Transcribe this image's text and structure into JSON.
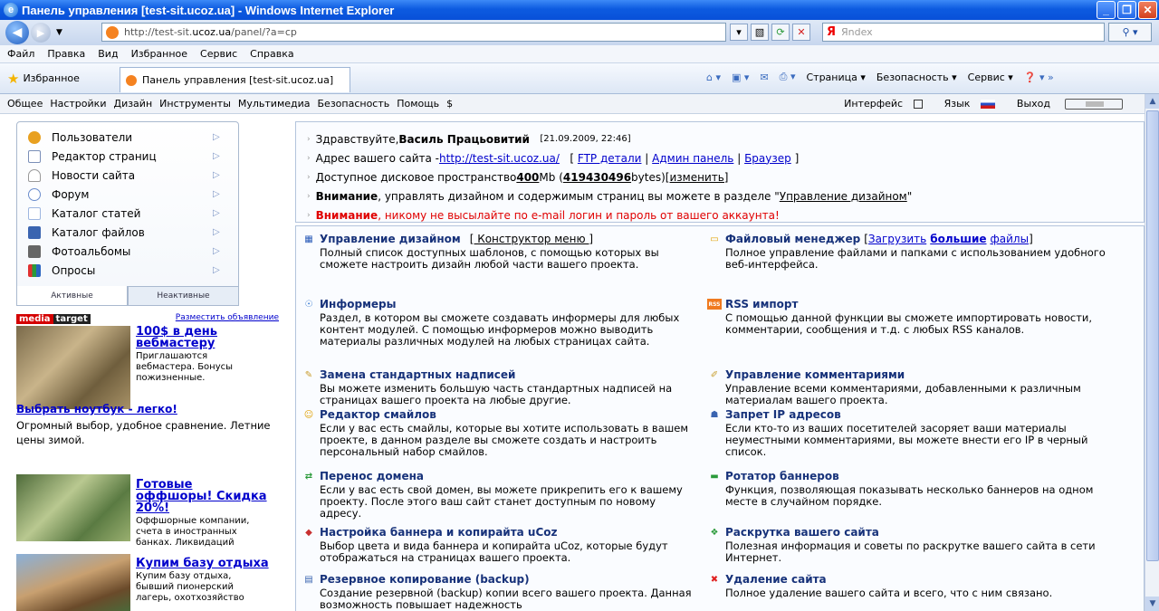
{
  "window": {
    "title": "Панель управления [test-sit.ucoz.ua] - Windows Internet Explorer"
  },
  "address": {
    "prefix": "http://test-sit.",
    "host": "ucoz.ua",
    "path": "/panel/?a=cp"
  },
  "search": {
    "placeholder": "Яndex",
    "logo": "Я"
  },
  "menu": [
    "Файл",
    "Правка",
    "Вид",
    "Избранное",
    "Сервис",
    "Справка"
  ],
  "favorites": {
    "label": "Избранное",
    "tab": "Панель управления [test-sit.ucoz.ua]"
  },
  "commands": {
    "page": "Страница ▾",
    "security": "Безопасность ▾",
    "service": "Сервис ▾"
  },
  "topnav": {
    "items": [
      "Общее",
      "Настройки",
      "Дизайн",
      "Инструменты",
      "Мультимедиа",
      "Безопасность",
      "Помощь",
      "$"
    ],
    "interface": "Интерфейс",
    "language": "Язык",
    "logout": "Выход"
  },
  "sidebar": {
    "items": [
      {
        "label": "Пользователи",
        "color": "#e8a020"
      },
      {
        "label": "Редактор страниц",
        "color": "#7a8fb8"
      },
      {
        "label": "Новости сайта",
        "color": "#c0c8d8"
      },
      {
        "label": "Форум",
        "color": "#6a8ccc"
      },
      {
        "label": "Каталог статей",
        "color": "#9db6e0"
      },
      {
        "label": "Каталог файлов",
        "color": "#3a64b0"
      },
      {
        "label": "Фотоальбомы",
        "color": "#555555"
      },
      {
        "label": "Опросы",
        "color": "#2a9a3a"
      }
    ],
    "tab_active": "Активные",
    "tab_inactive": "Неактивные"
  },
  "ad": {
    "brand1": "media",
    "brand2": "target",
    "place": "Разместить объявление",
    "a1_title": "100$ в день вебмастеру",
    "a1_text": "Приглашаются вебмастера. Бонусы пожизненные.",
    "a2_title": "Выбрать ноутбук - легко!",
    "a2_text": "Огромный выбор, удобное сравнение. Летние цены зимой.",
    "a3_title": "Готовые оффшоры! Скидка 20%!",
    "a3_text": "Оффшорные компании, счета в иностранных банках. Ликвидаций",
    "a4_title": "Купим базу отдыха",
    "a4_text": "Купим базу отдыха, бывший пионерский лагерь, охотхозяйство"
  },
  "info": {
    "hello": "Здравствуйте, ",
    "user": "Василь Працьовитий",
    "date": "[21.09.2009, 22:46]",
    "addr_label": "Адрес вашего сайта - ",
    "site": "http://test-sit.ucoz.ua/",
    "bracket_open": "[",
    "ftp": "FTP детали",
    "sep": "|",
    "admin": "Админ панель",
    "browser": "Браузер",
    "bracket_close": "]",
    "space_label": "Доступное дисковое пространство ",
    "space_mb": "400",
    "space_unit": " Mb (",
    "space_bytes": "419430496",
    "space_tail": " bytes) ",
    "change": "[изменить]",
    "warn_word": "Внимание",
    "warn1": ", управлять дизайном и содержимым страниц вы можете в разделе \"",
    "warn1_link": "Управление дизайном",
    "warn1_end": "\"",
    "warn2": ", никому не высылайте по e-mail логин и пароль от вашего аккаунта!"
  },
  "tools_left": [
    {
      "title": "Управление дизайном",
      "extra": "[ Конструктор меню ]",
      "desc": "Полный список доступных шаблонов, с помощью которых вы сможете настроить дизайн любой части вашего проекта.",
      "icon": "▦",
      "color": "#2a5bb8"
    },
    {
      "title": "Информеры",
      "desc": "Раздел, в котором вы сможете создавать информеры для любых контент модулей. С помощью информеров можно выводить материалы различных модулей на любых страницах сайта.",
      "icon": "☉",
      "color": "#3a7bd0"
    },
    {
      "title": "Замена стандартных надписей",
      "desc": "Вы можете изменить большую часть стандартных надписей на страницах вашего проекта на любые другие.",
      "icon": "✎",
      "color": "#c89a2a"
    },
    {
      "title": "Редактор смайлов",
      "desc": "Если у вас есть смайлы, которые вы хотите использовать в вашем проекте, в данном разделе вы сможете создать и настроить персональный набор смайлов.",
      "icon": "☺",
      "color": "#e0a000"
    },
    {
      "title": "Перенос домена",
      "desc": "Если у вас есть свой домен, вы можете прикрепить его к вашему проекту. После этого ваш сайт станет доступным по новому адресу.",
      "icon": "⇄",
      "color": "#2a9a3a"
    },
    {
      "title": "Настройка баннера и копирайта uCoz",
      "desc": "Выбор цвета и вида баннера и копирайта uCoz, которые будут отображаться на страницах вашего проекта.",
      "icon": "◆",
      "color": "#c83030"
    },
    {
      "title": "Резервное копирование (backup)",
      "desc": "Создание резервной (backup) копии всего вашего проекта. Данная возможность повышает надежность",
      "icon": "▤",
      "color": "#3a64b0"
    }
  ],
  "tools_right": [
    {
      "title": "Файловый менеджер",
      "extra_pre": "[",
      "extra1": "Загрузить",
      "extra2": "большие",
      "extra3": "файлы",
      "extra_post": "]",
      "desc": "Полное управление файлами и папками с использованием удобного веб-интерфейса.",
      "icon": "▭",
      "color": "#e0a000"
    },
    {
      "title": "RSS импорт",
      "desc": "С помощью данной функции вы сможете импортировать новости, комментарии, сообщения и т.д. с любых RSS каналов.",
      "icon": "RSS",
      "color": "#f07a20"
    },
    {
      "title": "Управление комментариями",
      "desc": "Управление всеми комментариями, добавленными к различным материалам вашего проекта.",
      "icon": "✐",
      "color": "#c8a030"
    },
    {
      "title": "Запрет IP адресов",
      "desc": "Если кто-то из ваших посетителей засоряет ваши материалы неуместными комментариями, вы можете внести его IP в черный список.",
      "icon": "☗",
      "color": "#3a64b0"
    },
    {
      "title": "Ротатор баннеров",
      "desc": "Функция, позволяющая показывать несколько баннеров на одном месте в случайном порядке.",
      "icon": "▬",
      "color": "#2a9a3a"
    },
    {
      "title": "Раскрутка вашего сайта",
      "desc": "Полезная информация и советы по раскрутке вашего сайта в сети Интернет.",
      "icon": "❖",
      "color": "#2a9a3a"
    },
    {
      "title": "Удаление сайта",
      "desc": "Полное удаление вашего сайта и всего, что с ним связано.",
      "icon": "✖",
      "color": "#e02020"
    }
  ]
}
